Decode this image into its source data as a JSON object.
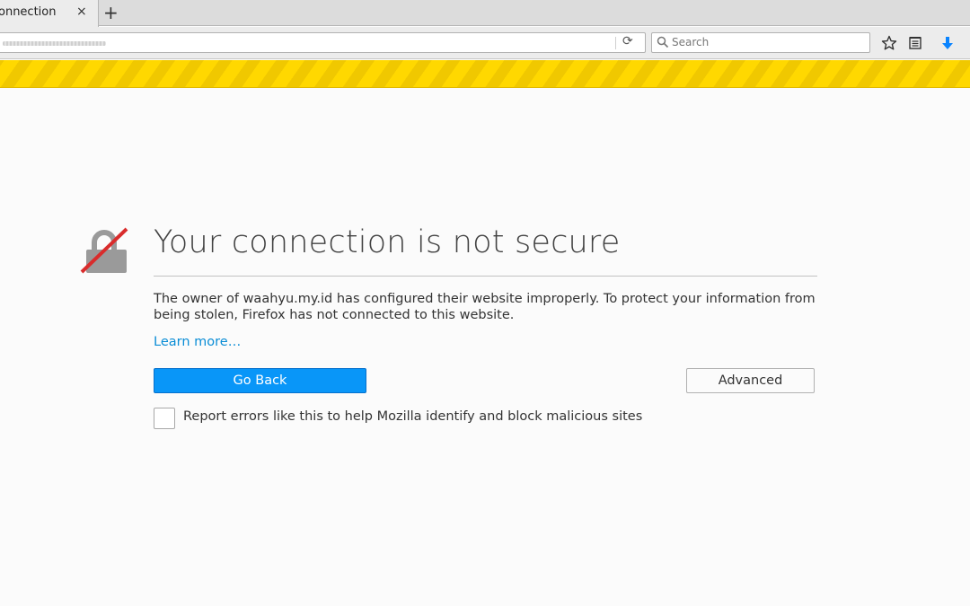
{
  "tab": {
    "title": "onnection",
    "close_glyph": "×",
    "new_tab_glyph": "+"
  },
  "navbar": {
    "reload_glyph": "⟳",
    "search_placeholder": "Search",
    "icons": [
      "reload-icon",
      "search-icon",
      "bookmark-star-icon",
      "reading-list-icon",
      "download-arrow-icon"
    ]
  },
  "error": {
    "title": "Your connection is not secure",
    "description": "The owner of waahyu.my.id has configured their website improperly. To protect your information from being stolen, Firefox has not connected to this website.",
    "learn_more": "Learn more…",
    "go_back_label": "Go Back",
    "advanced_label": "Advanced",
    "report_label": "Report errors like this to help Mozilla identify and block malicious sites",
    "report_checked": false
  },
  "colors": {
    "primary_button": "#0996f8",
    "link": "#0a8dd6",
    "warning_stripe": "#ffd800",
    "lock_slash": "#d92c2c"
  }
}
